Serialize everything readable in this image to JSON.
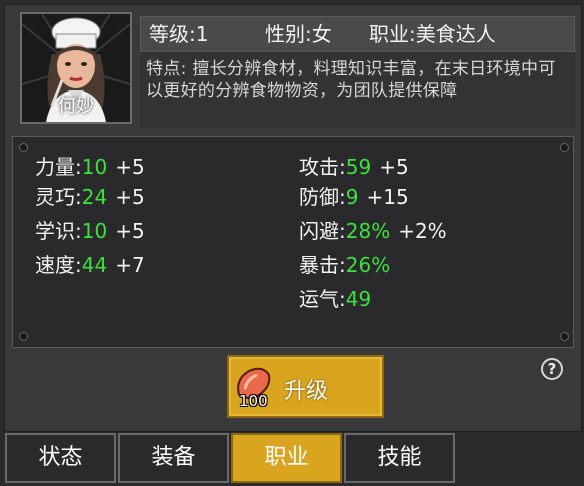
{
  "character": {
    "name": "何妙",
    "level": "等级:1",
    "gender": "性别:女",
    "profession": "职业:美食达人",
    "description": "特点: 擅长分辨食材，料理知识丰富，在末日环境中可以更好的分辨食物物资，为团队提供保障"
  },
  "stats_left": [
    {
      "label": "力量:",
      "value": "10",
      "bonus": "+5"
    },
    {
      "label": "灵巧:",
      "value": "24",
      "bonus": "+5"
    },
    {
      "label": "学识:",
      "value": "10",
      "bonus": "+5"
    },
    {
      "label": "速度:",
      "value": "44",
      "bonus": "+7"
    }
  ],
  "stats_right": [
    {
      "label": "攻击:",
      "value": "59",
      "bonus": "+5"
    },
    {
      "label": "防御:",
      "value": "9",
      "bonus": "+15"
    },
    {
      "label": "闪避:",
      "value": "28%",
      "bonus": "+2%"
    },
    {
      "label": "暴击:",
      "value": "26%",
      "bonus": ""
    },
    {
      "label": "运气:",
      "value": "49",
      "bonus": ""
    }
  ],
  "upgrade": {
    "label": "升级",
    "cost": "100"
  },
  "help": {
    "label": "?"
  },
  "tabs": [
    {
      "label": "状态",
      "active": false
    },
    {
      "label": "装备",
      "active": false
    },
    {
      "label": "职业",
      "active": true
    },
    {
      "label": "技能",
      "active": false
    }
  ],
  "colors": {
    "accent": "#d9a41e",
    "value": "#3be03b",
    "panel": "#2a2a2c"
  }
}
